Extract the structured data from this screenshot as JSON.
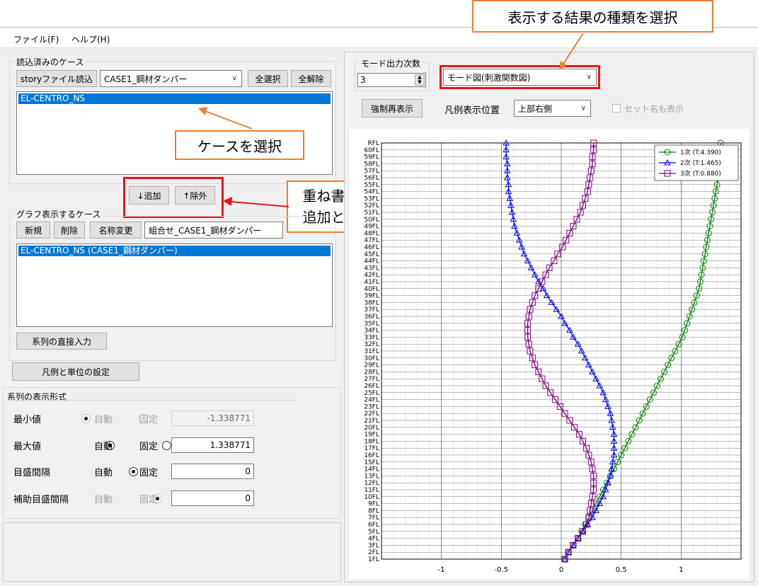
{
  "menu": {
    "file": "ファイル(F)",
    "help": "ヘルプ(H)"
  },
  "loaded_cases": {
    "title": "読込済みのケース",
    "story_button": "storyファイル読込",
    "case_select": "CASE1_鋼材ダンパー",
    "select_all": "全選択",
    "deselect_all": "全解除",
    "items": [
      "EL-CENTRO_NS"
    ]
  },
  "move_buttons": {
    "add": "↓追加",
    "remove": "↑除外"
  },
  "graph_cases": {
    "title": "グラフ表示するケース",
    "new_button": "新規",
    "delete_button": "削除",
    "rename_button": "名称変更",
    "combo_label": "組合せ_CASE1_鋼材ダンパー",
    "items": [
      "EL-CENTRO_NS (CASE1_鋼材ダンパー)"
    ],
    "direct_input_button": "系列の直接入力"
  },
  "legend_units_button": "凡例と単位の設定",
  "series_format": {
    "title": "系列の表示形式",
    "auto_label": "自動",
    "fixed_label": "固定",
    "rows": [
      {
        "label": "最小値",
        "value": "-1.338771",
        "mode": "auto",
        "enabled": false
      },
      {
        "label": "最大値",
        "value": "1.338771",
        "mode": "auto",
        "enabled": true
      },
      {
        "label": "目盛間隔",
        "value": "0",
        "mode": "auto",
        "enabled": true
      },
      {
        "label": "補助目盛間隔",
        "value": "0",
        "mode": "auto",
        "enabled": false
      }
    ]
  },
  "toolbar": {
    "mode_count_label": "モード出力次数",
    "mode_count_value": "3",
    "result_type": "モード図(刺激関数図)",
    "refresh_button": "強制再表示",
    "legend_pos_label": "凡例表示位置",
    "legend_pos_value": "上部右側",
    "setname_checkbox": "セット名も表示"
  },
  "annotations": {
    "result_type": "表示する結果の種類を選択",
    "case_select": "ケースを選択",
    "overlay": "重ね書きの\n追加と削除"
  },
  "colors": {
    "accent_callout": "#ed7d31",
    "highlight_box": "#e8141a",
    "selection": "#0078d7"
  },
  "chart_data": {
    "type": "line",
    "xlim": [
      -1.5,
      1.5
    ],
    "x_ticks": [
      -1,
      -0.5,
      0,
      0.5,
      1
    ],
    "x_tick_labels": [
      "-1",
      "-0.5",
      "0",
      "0.5",
      "1"
    ],
    "y_levels": [
      "1FL",
      "2FL",
      "3FL",
      "4FL",
      "5FL",
      "6FL",
      "7FL",
      "8FL",
      "9FL",
      "10FL",
      "11FL",
      "12FL",
      "13FL",
      "14FL",
      "15FL",
      "16FL",
      "17FL",
      "18FL",
      "19FL",
      "20FL",
      "21FL",
      "22FL",
      "23FL",
      "24FL",
      "25FL",
      "26FL",
      "27FL",
      "28FL",
      "29FL",
      "30FL",
      "31FL",
      "32FL",
      "33FL",
      "34FL",
      "35FL",
      "36FL",
      "37FL",
      "38FL",
      "39FL",
      "40FL",
      "41FL",
      "42FL",
      "43FL",
      "44FL",
      "45FL",
      "46FL",
      "47FL",
      "48FL",
      "49FL",
      "50FL",
      "51FL",
      "52FL",
      "53FL",
      "54FL",
      "55FL",
      "56FL",
      "57FL",
      "58FL",
      "59FL",
      "60FL",
      "RFL"
    ],
    "grid": true,
    "legend_position": "top-right",
    "series": [
      {
        "name": "1次 (T:4.390)",
        "color": "#008000",
        "marker": "circle",
        "values": [
          0.03,
          0.06,
          0.1,
          0.14,
          0.17,
          0.2,
          0.23,
          0.26,
          0.29,
          0.32,
          0.35,
          0.38,
          0.41,
          0.44,
          0.47,
          0.5,
          0.53,
          0.56,
          0.59,
          0.62,
          0.65,
          0.68,
          0.71,
          0.74,
          0.77,
          0.8,
          0.83,
          0.86,
          0.89,
          0.92,
          0.95,
          0.98,
          1.01,
          1.03,
          1.05,
          1.07,
          1.09,
          1.11,
          1.13,
          1.15,
          1.16,
          1.17,
          1.18,
          1.19,
          1.2,
          1.21,
          1.22,
          1.23,
          1.24,
          1.25,
          1.26,
          1.27,
          1.28,
          1.29,
          1.3,
          1.31,
          1.31,
          1.32,
          1.32,
          1.33,
          1.33
        ]
      },
      {
        "name": "2次 (T:1.465)",
        "color": "#0000ff",
        "marker": "triangle",
        "values": [
          0.03,
          0.06,
          0.1,
          0.14,
          0.18,
          0.22,
          0.26,
          0.29,
          0.32,
          0.35,
          0.37,
          0.39,
          0.41,
          0.42,
          0.43,
          0.44,
          0.44,
          0.44,
          0.44,
          0.43,
          0.42,
          0.41,
          0.39,
          0.37,
          0.35,
          0.32,
          0.29,
          0.26,
          0.23,
          0.2,
          0.17,
          0.14,
          0.1,
          0.07,
          0.03,
          0.0,
          -0.04,
          -0.08,
          -0.12,
          -0.15,
          -0.19,
          -0.22,
          -0.25,
          -0.28,
          -0.31,
          -0.33,
          -0.35,
          -0.37,
          -0.39,
          -0.4,
          -0.41,
          -0.42,
          -0.43,
          -0.44,
          -0.44,
          -0.45,
          -0.45,
          -0.45,
          -0.46,
          -0.46,
          -0.46
        ]
      },
      {
        "name": "3次 (T:0.880)",
        "color": "#800080",
        "marker": "square",
        "values": [
          0.03,
          0.06,
          0.1,
          0.14,
          0.18,
          0.21,
          0.23,
          0.24,
          0.25,
          0.26,
          0.27,
          0.27,
          0.27,
          0.26,
          0.25,
          0.23,
          0.21,
          0.18,
          0.15,
          0.11,
          0.07,
          0.03,
          -0.01,
          -0.05,
          -0.09,
          -0.13,
          -0.16,
          -0.19,
          -0.22,
          -0.24,
          -0.26,
          -0.27,
          -0.28,
          -0.28,
          -0.28,
          -0.27,
          -0.26,
          -0.24,
          -0.22,
          -0.19,
          -0.16,
          -0.13,
          -0.1,
          -0.06,
          -0.03,
          0.01,
          0.04,
          0.07,
          0.1,
          0.13,
          0.16,
          0.18,
          0.2,
          0.22,
          0.23,
          0.24,
          0.25,
          0.26,
          0.26,
          0.27,
          0.27
        ]
      }
    ]
  }
}
